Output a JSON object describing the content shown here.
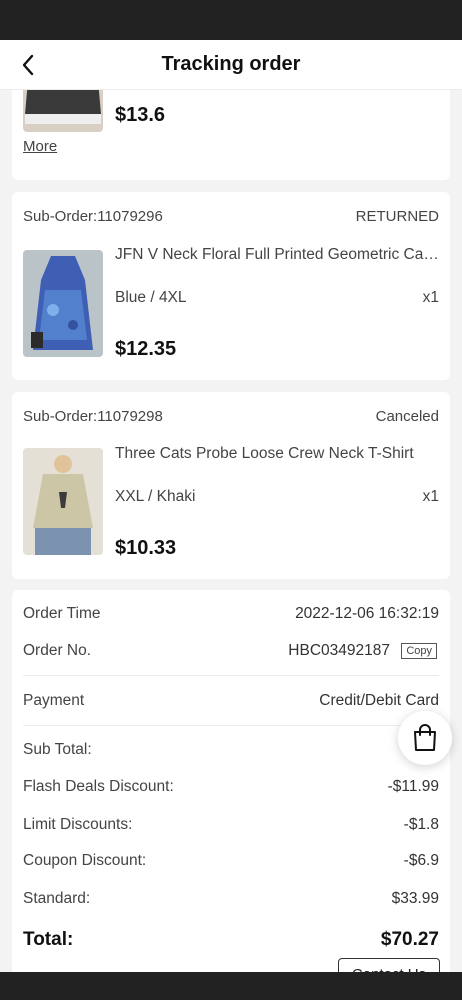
{
  "header": {
    "title": "Tracking order"
  },
  "first_card": {
    "price": "$13.6",
    "more_label": "More"
  },
  "sub_orders": [
    {
      "id_label": "Sub-Order:11079296",
      "status": "RETURNED",
      "name": "JFN V Neck Floral Full Printed Geometric Casual Dress",
      "variant": "Blue / 4XL",
      "qty": "x1",
      "price": "$12.35"
    },
    {
      "id_label": "Sub-Order:11079298",
      "status": "Canceled",
      "name": "Three Cats Probe Loose Crew Neck T-Shirt",
      "variant": "XXL / Khaki",
      "qty": "x1",
      "price": "$10.33"
    }
  ],
  "summary": {
    "order_time_label": "Order Time",
    "order_time_value": "2022-12-06 16:32:19",
    "order_no_label": "Order No.",
    "order_no_value": "HBC03492187",
    "copy_label": "Copy",
    "payment_label": "Payment",
    "payment_value": "Credit/Debit Card",
    "subtotal_label": "Sub Total:",
    "subtotal_value": "$...",
    "flash_label": "Flash Deals Discount:",
    "flash_value": "-$11.99",
    "limit_label": "Limit Discounts:",
    "limit_value": "-$1.8",
    "coupon_label": "Coupon Discount:",
    "coupon_value": "-$6.9",
    "standard_label": "Standard:",
    "standard_value": "$33.99",
    "total_label": "Total:",
    "total_value": "$70.27",
    "contact_label": "Contact Us"
  },
  "colors": {
    "status_bar": "#222222",
    "background": "#f3f3f3",
    "card": "#ffffff"
  },
  "icons": {
    "back": "chevron-left-icon",
    "cart": "shopping-bag-icon"
  }
}
